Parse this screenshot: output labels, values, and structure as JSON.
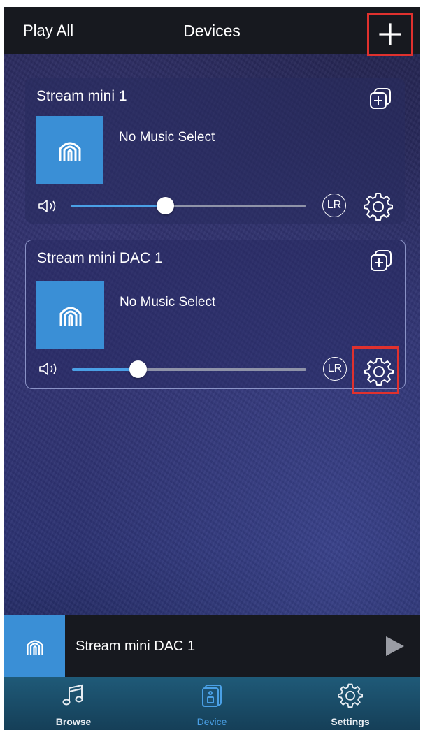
{
  "header": {
    "play_all_label": "Play All",
    "title": "Devices",
    "add_icon": "plus-icon"
  },
  "devices": [
    {
      "name": "Stream mini 1",
      "now_playing": "No Music Select",
      "volume_percent": 40,
      "channel_label": "LR",
      "selected": false
    },
    {
      "name": "Stream mini DAC 1",
      "now_playing": "No Music Select",
      "volume_percent": 28,
      "channel_label": "LR",
      "selected": true
    }
  ],
  "mini_player": {
    "device_name": "Stream mini DAC 1",
    "play_icon": "play-icon"
  },
  "tabs": [
    {
      "label": "Browse",
      "icon": "music-note-icon",
      "active": false
    },
    {
      "label": "Device",
      "icon": "speaker-icon",
      "active": true
    },
    {
      "label": "Settings",
      "icon": "gear-icon",
      "active": false
    }
  ],
  "colors": {
    "accent": "#4aa0e6",
    "art_blue": "#3a8fd6",
    "highlight_red": "#e0312e",
    "header_bg": "#17191f"
  }
}
